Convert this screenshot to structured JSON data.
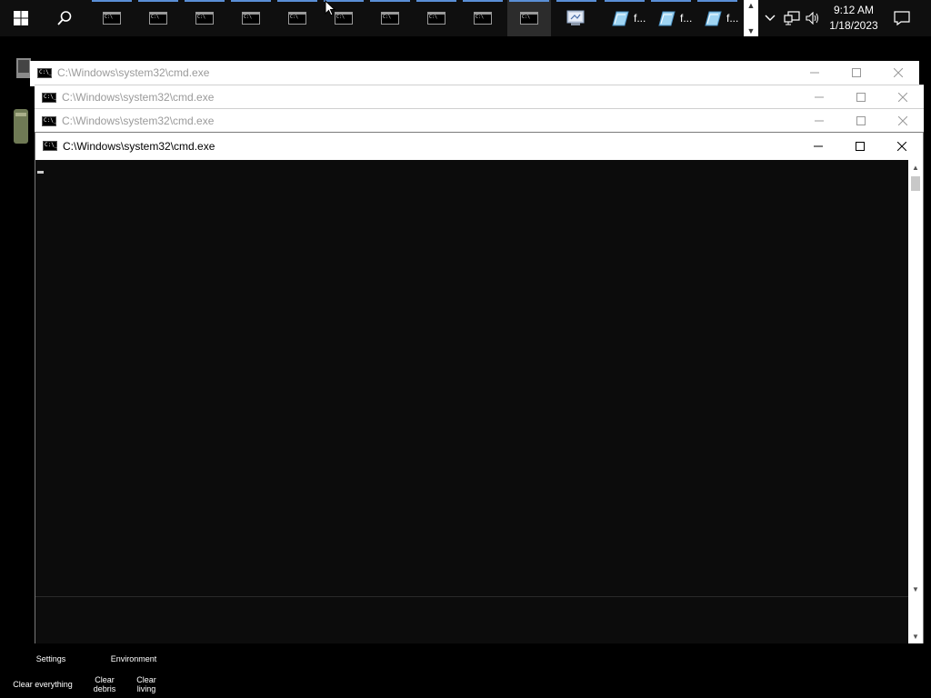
{
  "taskbar": {
    "start_icon": "windows-logo-icon",
    "search_icon": "search-icon",
    "cmd_app_icon": "cmd-icon",
    "ff_app_icon": "folder-pen-icon",
    "ff_apps": [
      {
        "label": "f..."
      },
      {
        "label": "f..."
      },
      {
        "label": "f..."
      }
    ],
    "settings_app_icon": "control-panel-icon",
    "tray_icons": [
      "chevron-down-icon",
      "network-icon",
      "volume-icon"
    ],
    "clock": {
      "time": "9:12 AM",
      "date": "1/18/2023"
    },
    "notification_icon": "notification-icon"
  },
  "windows": [
    {
      "title": "C:\\Windows\\system32\\cmd.exe",
      "state": "inactive"
    },
    {
      "title": "C:\\Windows\\system32\\cmd.exe",
      "state": "inactive"
    },
    {
      "title": "C:\\Windows\\system32\\cmd.exe",
      "state": "inactive"
    },
    {
      "title": "C:\\Windows\\system32\\cmd.exe",
      "state": "active"
    }
  ],
  "console": {
    "text": ""
  },
  "overlay": {
    "settings": "Settings",
    "environment": "Environment",
    "clear_everything": "Clear everything",
    "clear_debris": "Clear debris",
    "clear_living": "Clear living"
  },
  "colors": {
    "taskbar_bg": "#0f0f0f",
    "taskbar_accent": "#5a8fd6",
    "console_bg": "#0c0c0c",
    "titlebar_bg": "#ffffff"
  }
}
